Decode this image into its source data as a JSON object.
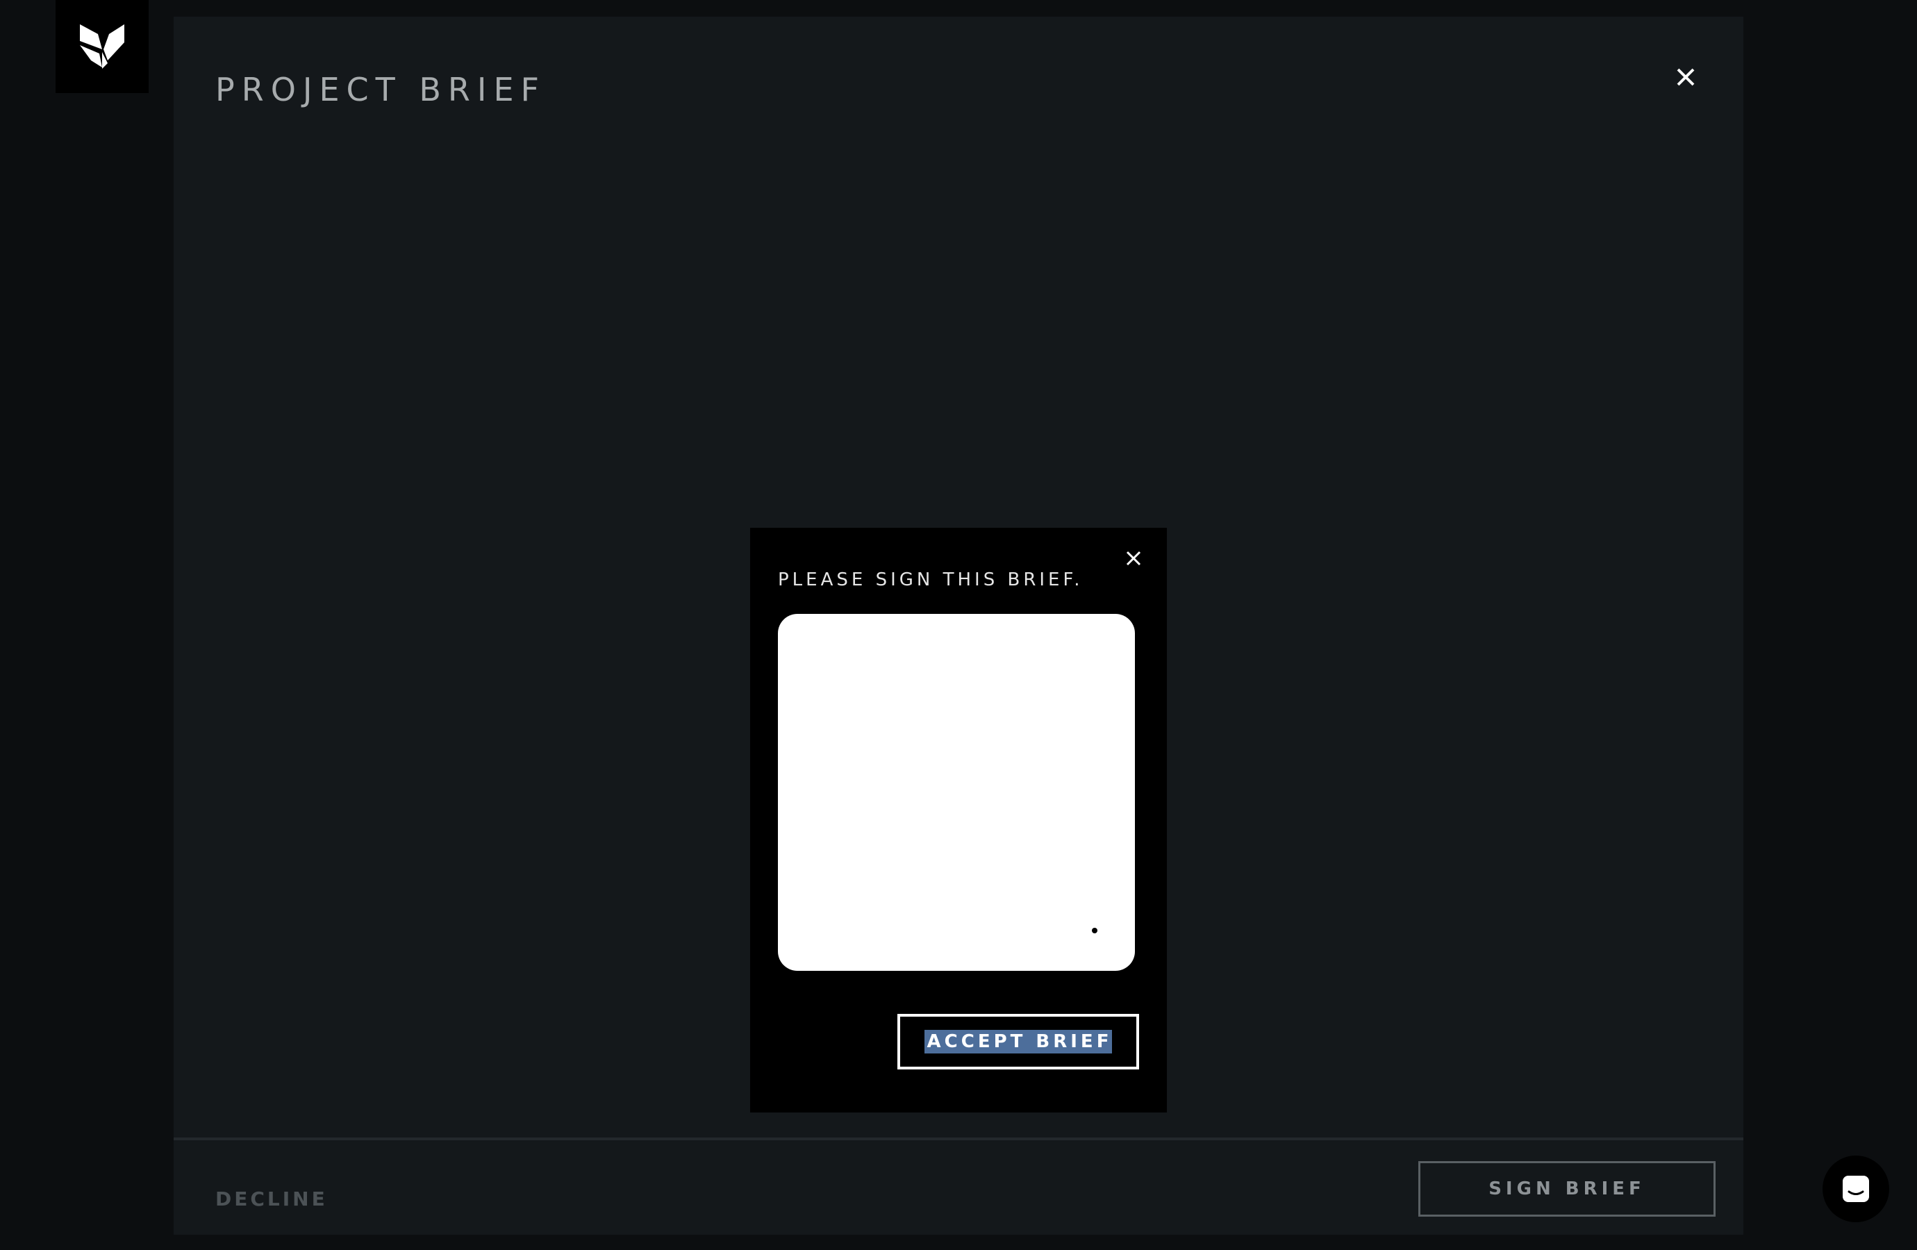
{
  "app": {
    "logo": "brand-shield-logo",
    "colors": {
      "page_background": "#0c0e10",
      "panel_background": "#14181b",
      "modal_background": "#000000",
      "selection_highlight": "#4d6e9b"
    }
  },
  "panel": {
    "title": "PROJECT BRIEF",
    "close_icon": "close-icon",
    "footer": {
      "decline_label": "DECLINE",
      "sign_label": "SIGN BRIEF"
    }
  },
  "modal": {
    "title": "PLEASE SIGN THIS BRIEF.",
    "close_icon": "close-icon",
    "signature_pad": "signature-canvas",
    "accept_label": "ACCEPT BRIEF"
  },
  "chat": {
    "icon": "chat-bubble-icon"
  }
}
